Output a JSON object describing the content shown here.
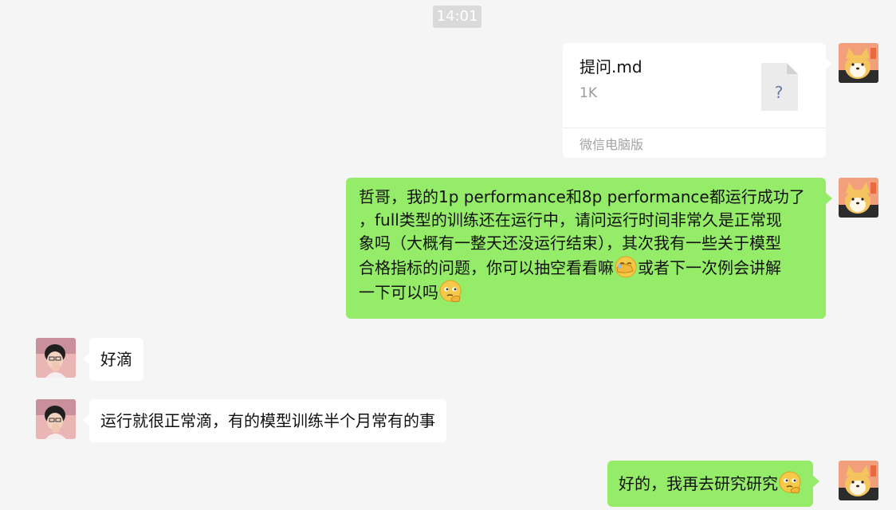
{
  "time_divider": "14:01",
  "file_message": {
    "name": "提问.md",
    "size": "1K",
    "icon_glyph": "?",
    "source": "微信电脑版"
  },
  "message_long": {
    "line1": "哲哥，我的1p performance和8p performance都运行成功了",
    "line2": "，full类型的训练还在运行中，请问运行时间非常久是正常现",
    "line3": "象吗（大概有一整天还没运行结束），其次我有一些关于模型",
    "line4a": "合格指标的问题，你可以抽空看看嘛",
    "line4b": "或者下一次例会讲解",
    "line5": "一下可以吗"
  },
  "message_reply1": "好滴",
  "message_reply2": "运行就很正常滴，有的模型训练半个月常有的事",
  "message_final": "好的，我再去研究研究",
  "emojis": [
    "facepalm-emoji",
    "thinking-emoji",
    "thinking-emoji"
  ],
  "colors": {
    "sent_bubble": "#95ec69",
    "received_bubble": "#ffffff",
    "background": "#f5f5f5"
  }
}
